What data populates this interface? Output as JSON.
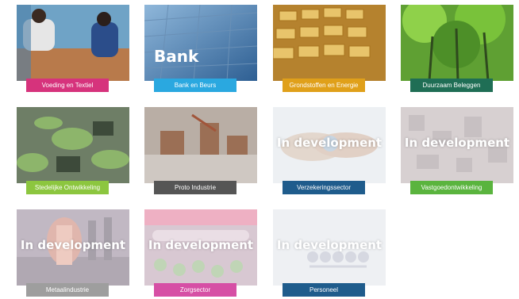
{
  "tiles": [
    {
      "label": "Voeding en Textiel",
      "color": "#d6337c"
    },
    {
      "label": "Bank en Beurs",
      "color": "#2aa8e0"
    },
    {
      "label": "Grondstoffen en Energie",
      "color": "#e0a01a"
    },
    {
      "label": "Duurzaam Beleggen",
      "color": "#1f6e55"
    },
    {
      "label": "Stedelijke Ontwikkeling",
      "color": "#8cc63f"
    },
    {
      "label": "Proto Industrie",
      "color": "#555555"
    },
    {
      "label": "Verzekeringssector",
      "color": "#1f5c8c"
    },
    {
      "label": "Vastgoedontwikkeling",
      "color": "#5ab43e"
    },
    {
      "label": "Metaalindustrie",
      "color": "#9e9e9e"
    },
    {
      "label": "Zorgsector",
      "color": "#d64fa5"
    },
    {
      "label": "Personeel",
      "color": "#1f5c8c"
    }
  ],
  "in_development_text": "In development"
}
